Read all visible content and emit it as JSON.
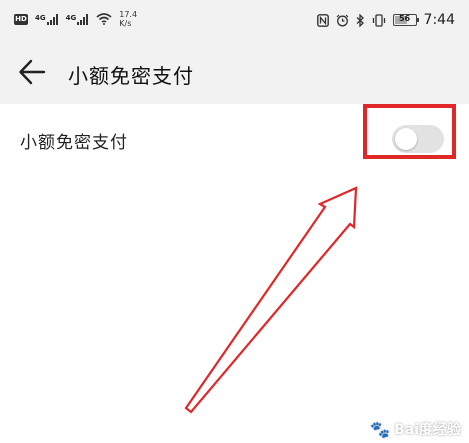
{
  "status_bar": {
    "network_type_1": "4G",
    "network_type_2": "4G",
    "speed_value": "17.4",
    "speed_unit": "K/s",
    "battery_level": "56",
    "time": "7:44"
  },
  "header": {
    "title": "小额免密支付"
  },
  "setting": {
    "label": "小额免密支付",
    "toggle_on": false
  },
  "watermark": {
    "text": "Bai度经验"
  },
  "colors": {
    "highlight": "#e02828",
    "header_bg": "#f2f2f2",
    "toggle_off": "#e2e2e2"
  },
  "icons": {
    "back": "arrow-left-icon",
    "nfc": "nfc-icon",
    "alarm": "alarm-icon",
    "bluetooth": "bluetooth-icon",
    "vibrate": "vibrate-icon",
    "wifi": "wifi-icon",
    "hd": "hd-icon"
  }
}
